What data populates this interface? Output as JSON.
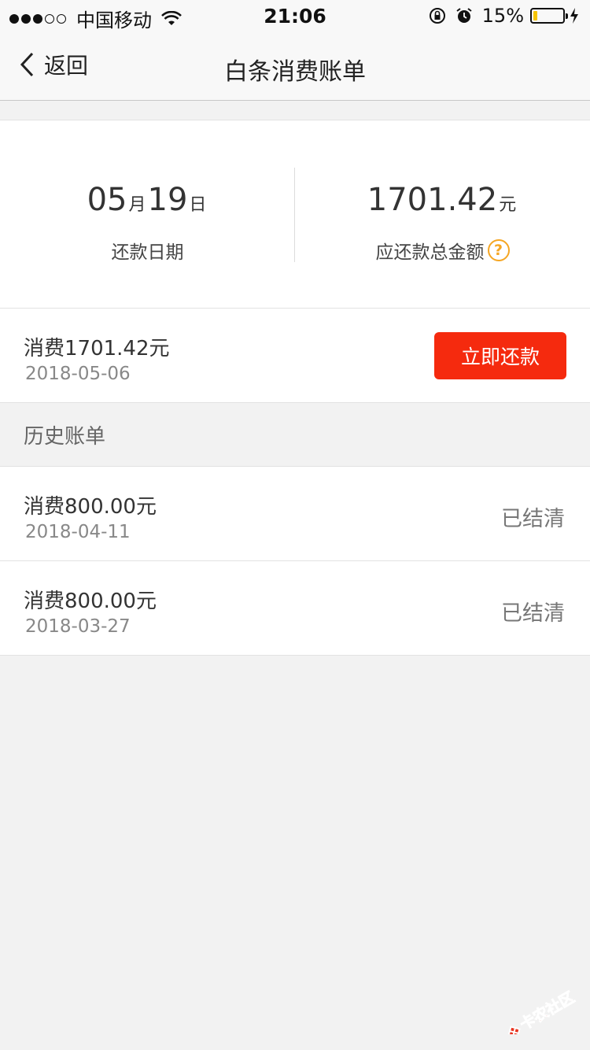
{
  "status_bar": {
    "carrier": "中国移动",
    "time": "21:06",
    "battery_percent": "15%",
    "battery_level": 0.15,
    "signal_filled": 3,
    "signal_total": 5
  },
  "nav": {
    "back_label": "返回",
    "title": "白条消费账单"
  },
  "summary": {
    "month": "05",
    "month_unit": "月",
    "day": "19",
    "day_unit": "日",
    "date_label": "还款日期",
    "amount": "1701.42",
    "amount_unit": "元",
    "amount_label": "应还款总金额",
    "help_icon_text": "?"
  },
  "current_bill": {
    "title": "消费1701.42元",
    "date": "2018-05-06",
    "pay_button": "立即还款"
  },
  "history": {
    "header": "历史账单",
    "items": [
      {
        "title": "消费800.00元",
        "date": "2018-04-11",
        "status": "已结清"
      },
      {
        "title": "消费800.00元",
        "date": "2018-03-27",
        "status": "已结清"
      }
    ]
  },
  "watermark": {
    "text": "卡农社区"
  },
  "colors": {
    "accent": "#f52a0e",
    "help_icon": "#f5a623",
    "battery": "#f5c400",
    "background": "#f2f2f2"
  }
}
